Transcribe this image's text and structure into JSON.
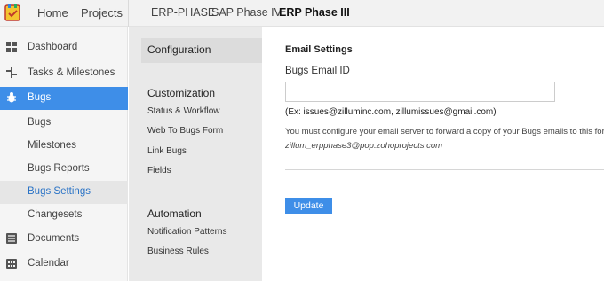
{
  "topbar": {
    "home": "Home",
    "projects": "Projects",
    "breadcrumbs": [
      "ERP-PHASE",
      "SAP Phase IV",
      "ERP Phase III"
    ]
  },
  "sidebar": {
    "items": [
      {
        "label": "Dashboard",
        "icon": "dashboard-icon"
      },
      {
        "label": "Tasks & Milestones",
        "icon": "tasks-icon"
      },
      {
        "label": "Bugs",
        "icon": "bug-icon"
      },
      {
        "label": "Bugs"
      },
      {
        "label": "Milestones"
      },
      {
        "label": "Bugs Reports"
      },
      {
        "label": "Bugs Settings"
      },
      {
        "label": "Changesets"
      },
      {
        "label": "Documents",
        "icon": "documents-icon"
      },
      {
        "label": "Calendar",
        "icon": "calendar-icon"
      }
    ]
  },
  "settings_nav": {
    "configuration": "Configuration",
    "customization": {
      "heading": "Customization",
      "links": [
        "Status & Workflow",
        "Web To Bugs Form",
        "Link Bugs",
        "Fields"
      ]
    },
    "automation": {
      "heading": "Automation",
      "links": [
        "Notification Patterns",
        "Business Rules"
      ]
    }
  },
  "main": {
    "heading": "Email Settings",
    "field_label": "Bugs Email ID",
    "field_value": "",
    "example": "(Ex: issues@zilluminc.com, zillumissues@gmail.com)",
    "note": "You must configure your email server to forward a copy of your Bugs emails to this forwa",
    "alias": "zillum_erpphase3@pop.zohoprojects.com",
    "update_button": "Update"
  },
  "colors": {
    "accent": "#3e8ee8",
    "selected_text": "#2a73c6"
  }
}
